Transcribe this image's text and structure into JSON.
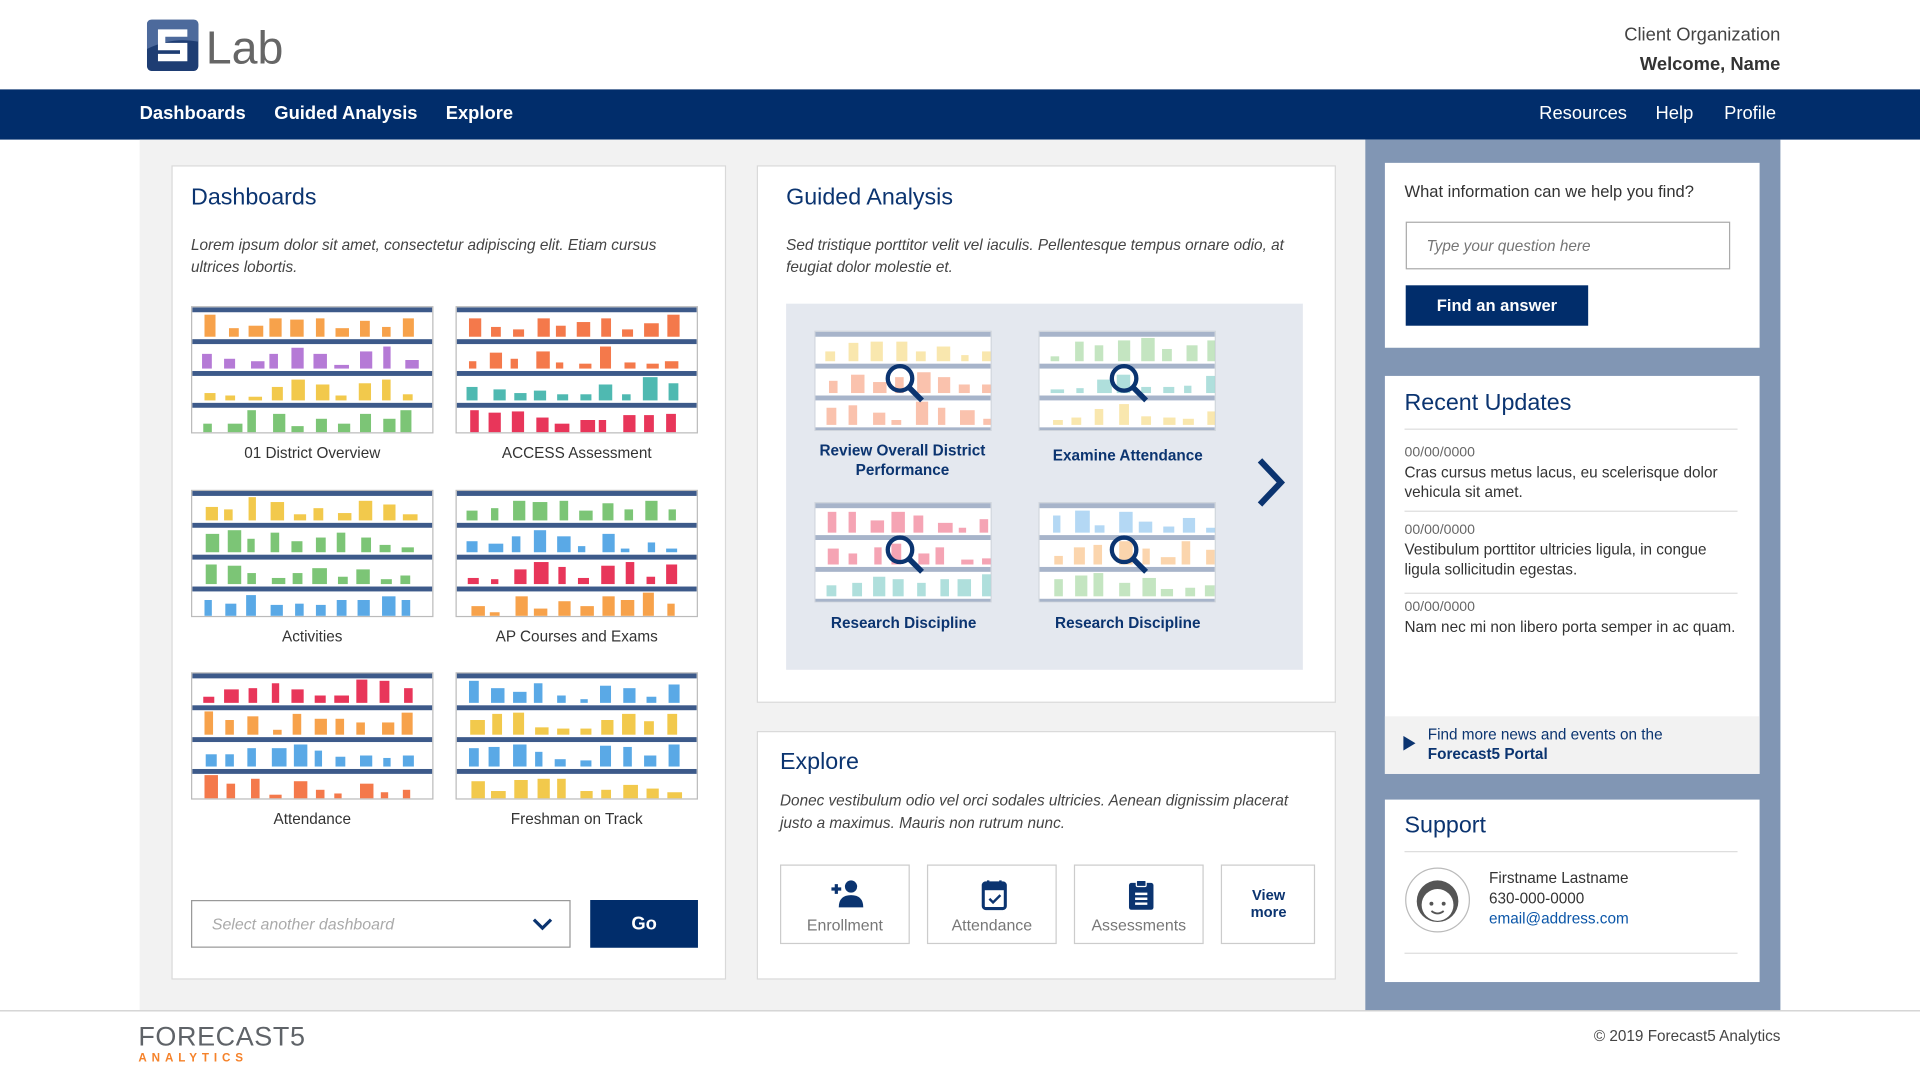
{
  "header": {
    "logo_text": "5Lab",
    "org": "Client Organization",
    "welcome": "Welcome, Name"
  },
  "nav": {
    "left": [
      "Dashboards",
      "Guided Analysis",
      "Explore"
    ],
    "right": [
      "Resources",
      "Help",
      "Profile"
    ]
  },
  "dashboards": {
    "title": "Dashboards",
    "description": "Lorem ipsum dolor sit amet, consectetur adipiscing elit. Etiam cursus ultrices lobortis.",
    "items": [
      "01 District Overview",
      "ACCESS Assessment",
      "Activities",
      "AP Courses and Exams",
      "Attendance",
      "Freshman on Track"
    ],
    "select_placeholder": "Select another dashboard",
    "go_label": "Go"
  },
  "guided": {
    "title": "Guided Analysis",
    "description": "Sed tristique porttitor velit vel iaculis. Pellentesque tempus ornare odio, at feugiat dolor molestie et.",
    "items": [
      "Review Overall District Performance",
      "Examine Attendance",
      "Research Discipline",
      "Research Discipline"
    ],
    "next_icon": "chevron-right-icon"
  },
  "explore": {
    "title": "Explore",
    "description": "Donec vestibulum odio vel orci sodales ultricies. Aenean dignissim placerat justo a maximus. Mauris non rutrum nunc.",
    "buttons": [
      {
        "label": "Enrollment",
        "icon": "add-person-icon"
      },
      {
        "label": "Attendance",
        "icon": "calendar-check-icon"
      },
      {
        "label": "Assessments",
        "icon": "clipboard-icon"
      }
    ],
    "view_more": "View more"
  },
  "search": {
    "question": "What information can we help you find?",
    "placeholder": "Type your question here",
    "button": "Find an answer"
  },
  "updates": {
    "title": "Recent Updates",
    "items": [
      {
        "date": "00/00/0000",
        "text": "Cras cursus metus lacus, eu scelerisque dolor vehicula sit amet."
      },
      {
        "date": "00/00/0000",
        "text": "Vestibulum porttitor ultricies ligula, in congue ligula sollicitudin egestas."
      },
      {
        "date": "00/00/0000",
        "text": "Nam nec mi non libero porta semper in ac quam."
      }
    ],
    "more_text": "Find more news and events on the",
    "more_link": "Forecast5 Portal"
  },
  "support": {
    "title": "Support",
    "name": "Firstname Lastname",
    "phone": "630-000-0000",
    "email": "email@address.com"
  },
  "footer": {
    "logo_main": "FORECAST5",
    "logo_sub": "ANALYTICS",
    "copyright": "© 2019 Forecast5 Analytics"
  },
  "colors": {
    "navy": "#012d6b",
    "sidebar": "#8196b4",
    "accent_orange": "#f5822a"
  }
}
